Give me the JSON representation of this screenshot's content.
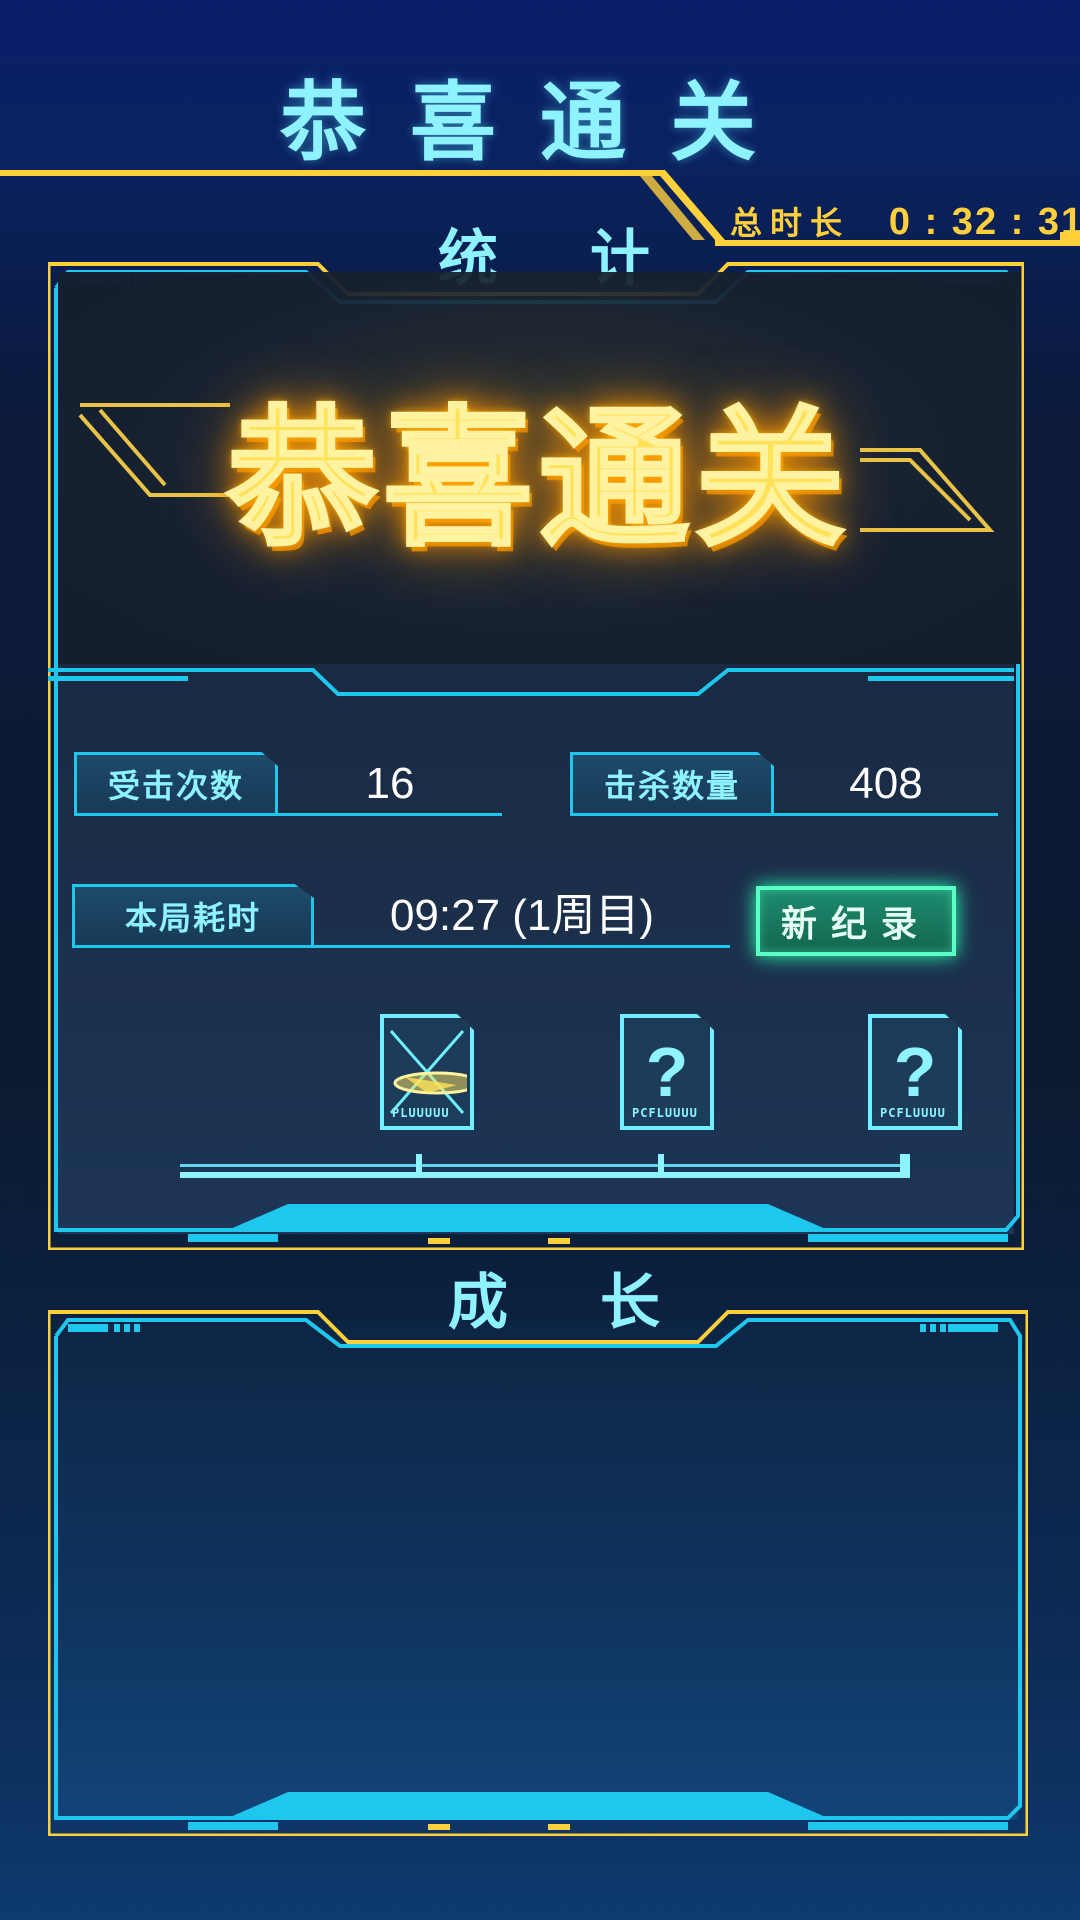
{
  "header": {
    "title": "恭喜通关",
    "total_time_label": "总时长",
    "total_time_value": "0 : 32 : 31"
  },
  "stats_panel": {
    "title": "统计",
    "banner_text": "恭喜通关",
    "hits_label": "受击次数",
    "hits_value": "16",
    "kills_label": "击杀数量",
    "kills_value": "408",
    "time_label": "本局耗时",
    "time_value": "09:27 (1周目)",
    "new_record_label": "新纪录",
    "reward_cards": [
      {
        "state": "unlocked",
        "icon": "ship-icon",
        "tag": "PLUUUUU"
      },
      {
        "state": "locked",
        "symbol": "?",
        "tag": "PCFLUUUU"
      },
      {
        "state": "locked",
        "symbol": "?",
        "tag": "PCFLUUUU"
      }
    ]
  },
  "growth_panel": {
    "title": "成长"
  },
  "colors": {
    "cyan": "#1fc6ee",
    "light_cyan": "#8ef3ff",
    "gold": "#ffd03c",
    "green": "#5affc6"
  }
}
